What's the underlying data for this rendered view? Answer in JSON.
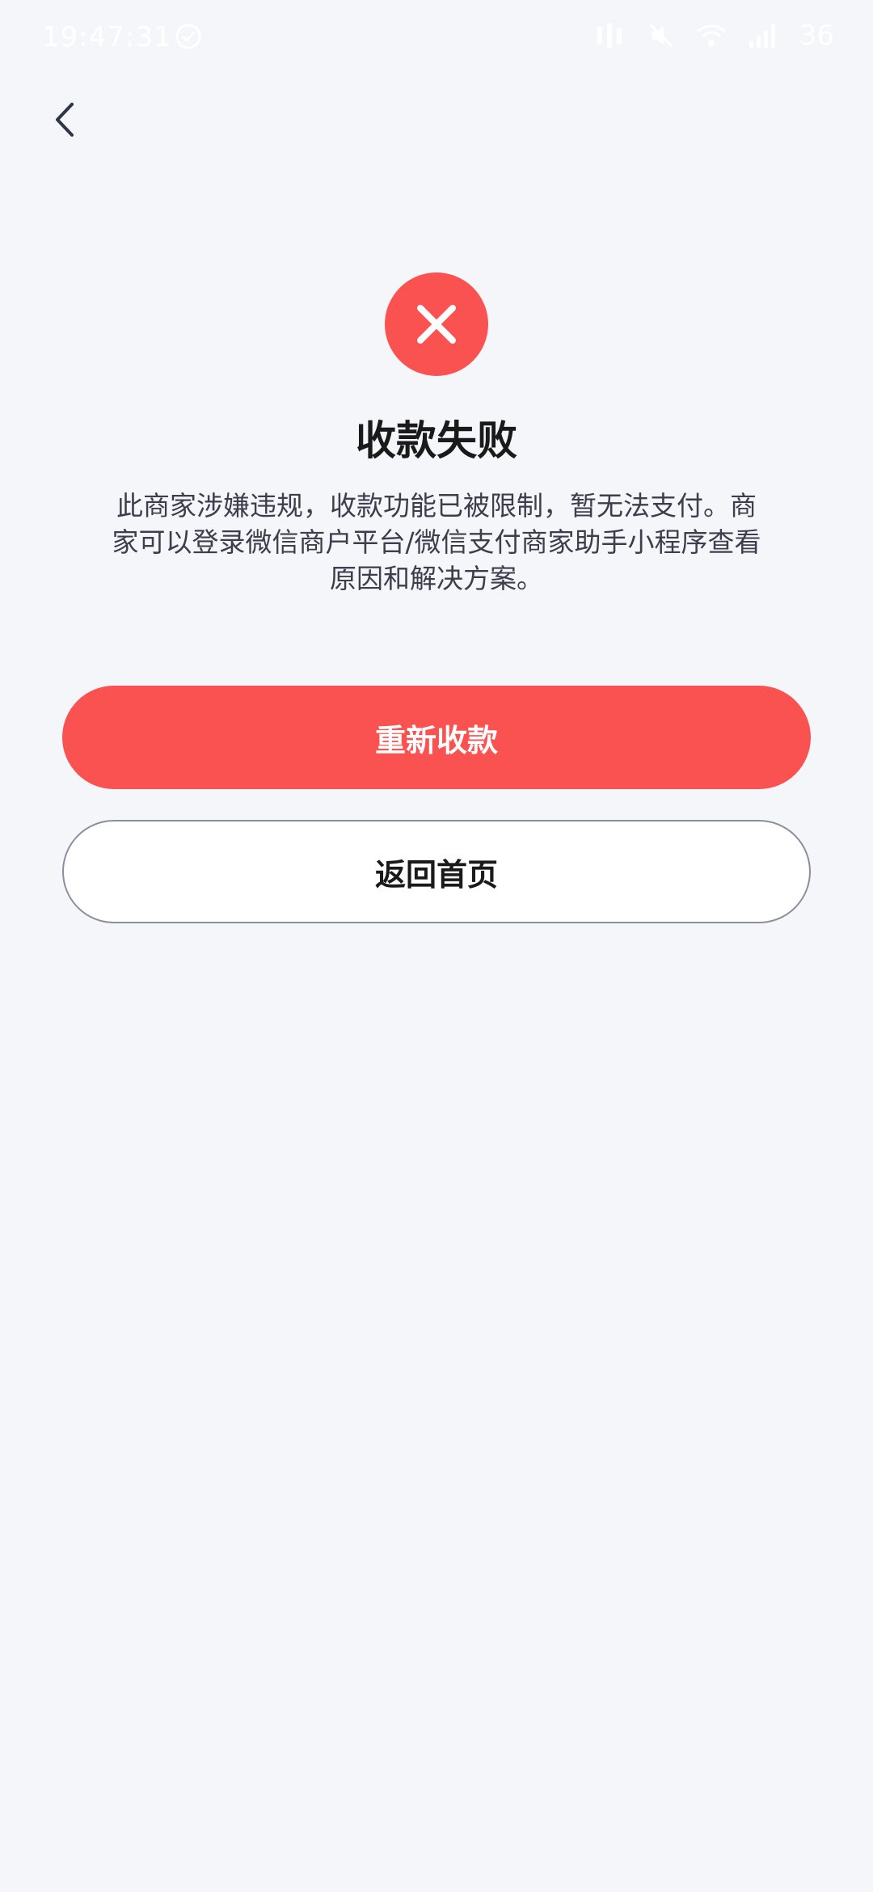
{
  "status_bar": {
    "time": "19:47:31",
    "battery": "36"
  },
  "page": {
    "title": "收款失败",
    "description": "此商家涉嫌违规，收款功能已被限制，暂无法支付。商家可以登录微信商户平台/微信支付商家助手小程序查看原因和解决方案。"
  },
  "buttons": {
    "retry_label": "重新收款",
    "home_label": "返回首页"
  },
  "colors": {
    "accent": "#fa5151",
    "background": "#f5f6fa",
    "title": "#1a1a1a",
    "body_text": "#3d3d4e"
  },
  "icons": {
    "back": "chevron-left-icon",
    "status": "close-circle-icon"
  }
}
